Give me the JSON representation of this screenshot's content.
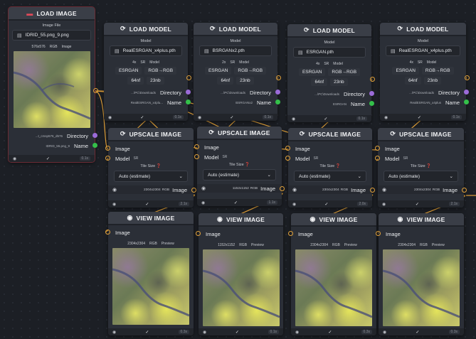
{
  "load_image": {
    "title": "LOAD IMAGE",
    "field_label": "Image File",
    "file": "IDRID_55.png_9.png",
    "meta": {
      "size": "576x576",
      "mode": "RGB",
      "kind": "Image"
    },
    "out_dir_value": "...t_cmsp576_d576",
    "out_dir_label": "Directory",
    "out_name_value": "IDRID_55.png_9",
    "out_name_label": "Name",
    "footer_time": "0.1s"
  },
  "models": [
    {
      "title": "LOAD MODEL",
      "label": "Model",
      "file": "RealESRGAN_x4plus.pth",
      "scale": "4x",
      "mode": "SR",
      "kind": "Model",
      "arch": "ESRGAN",
      "color": "RGB→RGB",
      "nf": "64nf",
      "nb": "23nb",
      "dir_value": "...\\PC\\Downloads",
      "dir_label": "Directory",
      "name_value": "RealESRGAN_x4plu...",
      "name_label": "Name",
      "time": "0.1s"
    },
    {
      "title": "LOAD MODEL",
      "label": "Model",
      "file": "BSRGANx2.pth",
      "scale": "2x",
      "mode": "SR",
      "kind": "Model",
      "arch": "ESRGAN",
      "color": "RGB→RGB",
      "nf": "64nf",
      "nb": "23nb",
      "dir_value": "...\\PC\\Downloads",
      "dir_label": "Directory",
      "name_value": "BSRGANx2",
      "name_label": "Name",
      "time": "0.1s"
    },
    {
      "title": "LOAD MODEL",
      "label": "Model",
      "file": "ESRGAN.pth",
      "scale": "4x",
      "mode": "SR",
      "kind": "Model",
      "arch": "ESRGAN",
      "color": "RGB→RGB",
      "nf": "64nf",
      "nb": "23nb",
      "dir_value": "...\\PC\\Downloads",
      "dir_label": "Directory",
      "name_value": "ESRGAN",
      "name_label": "Name",
      "time": "0.1s"
    },
    {
      "title": "LOAD MODEL",
      "label": "Model",
      "file": "RealESRGAN_x4plus.pth",
      "scale": "4x",
      "mode": "SR",
      "kind": "Model",
      "arch": "ESRGAN",
      "color": "RGB→RGB",
      "nf": "64nf",
      "nb": "23nb",
      "dir_value": "...\\PC\\Downloads",
      "dir_label": "Directory",
      "name_value": "RealESRGAN_x4plus",
      "name_label": "Name",
      "time": "0.1s"
    }
  ],
  "upscales": [
    {
      "title": "UPSCALE IMAGE",
      "in_image": "Image",
      "in_model": "Model",
      "in_model_tag": "SR",
      "tile_label": "Tile Size",
      "tile_value": "Auto (estimate)",
      "out_size": "2304x2304",
      "out_mode": "RGB",
      "out_label": "Image",
      "time": "2.1s"
    },
    {
      "title": "UPSCALE IMAGE",
      "in_image": "Image",
      "in_model": "Model",
      "in_model_tag": "SR",
      "tile_label": "Tile Size",
      "tile_value": "Auto (estimate)",
      "out_size": "1152x1152",
      "out_mode": "RGB",
      "out_label": "Image",
      "time": "1.1s"
    },
    {
      "title": "UPSCALE IMAGE",
      "in_image": "Image",
      "in_model": "Model",
      "in_model_tag": "SR",
      "tile_label": "Tile Size",
      "tile_value": "Auto (estimate)",
      "out_size": "2304x2304",
      "out_mode": "RGB",
      "out_label": "Image",
      "time": "2.0s"
    },
    {
      "title": "UPSCALE IMAGE",
      "in_image": "Image",
      "in_model": "Model",
      "in_model_tag": "SR",
      "tile_label": "Tile Size",
      "tile_value": "Auto (estimate)",
      "out_size": "2304x2304",
      "out_mode": "RGB",
      "out_label": "Image",
      "time": "2.1s"
    }
  ],
  "views": [
    {
      "title": "VIEW IMAGE",
      "in_image": "Image",
      "size": "2304x2304",
      "mode": "RGB",
      "kind": "Preview",
      "time": "0.3s"
    },
    {
      "title": "VIEW IMAGE",
      "in_image": "Image",
      "size": "1152x1152",
      "mode": "RGB",
      "kind": "Preview",
      "time": "0.1s"
    },
    {
      "title": "VIEW IMAGE",
      "in_image": "Image",
      "size": "2304x2304",
      "mode": "RGB",
      "kind": "Preview",
      "time": "0.3s"
    },
    {
      "title": "VIEW IMAGE",
      "in_image": "Image",
      "size": "2304x2304",
      "mode": "RGB",
      "kind": "Preview",
      "time": "0.3s"
    }
  ],
  "colors": {
    "wire": "#e3a23a",
    "directory_port": "#9b6bd8",
    "name_port": "#34c04a",
    "selected_outline": "#6b2b34",
    "canvas": "#1c1f25"
  },
  "icons": {
    "load_image": "image-icon",
    "load_model": "model-icon",
    "upscale": "upscale-icon",
    "view": "eye-icon",
    "file": "file-icon",
    "check": "check-icon"
  }
}
